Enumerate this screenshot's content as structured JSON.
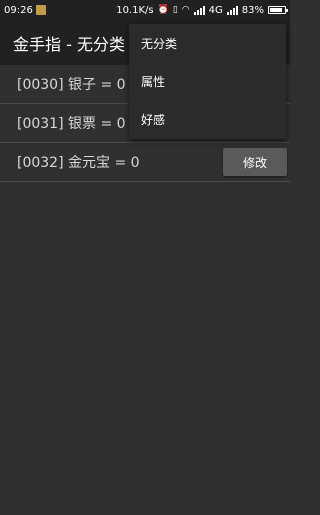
{
  "statusbar": {
    "time": "09:26",
    "net_speed": "10.1K/s",
    "network_type": "4G",
    "battery_percent": "83%",
    "battery_level": 0.83
  },
  "appbar": {
    "title": "金手指 - 无分类"
  },
  "list": {
    "rows": [
      {
        "text": "[0030] 银子 = 0"
      },
      {
        "text": "[0031] 银票 = 0"
      },
      {
        "text": "[0032] 金元宝 = 0",
        "button": "修改"
      }
    ]
  },
  "dropdown": {
    "items": [
      {
        "label": "无分类"
      },
      {
        "label": "属性"
      },
      {
        "label": "好感"
      }
    ]
  }
}
